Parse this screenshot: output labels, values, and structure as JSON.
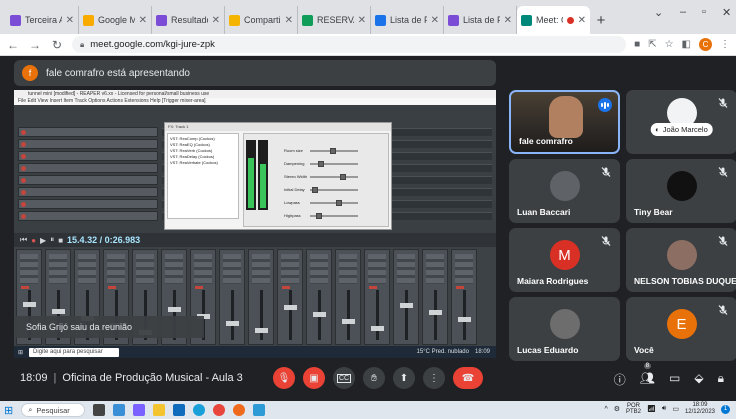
{
  "browser": {
    "tabs": [
      {
        "label": "Terceira Aula",
        "color": "#7b4dd6",
        "active": false
      },
      {
        "label": "Google Meet",
        "color": "#f9ab00",
        "active": false
      },
      {
        "label": "Resultados d",
        "color": "#7b4dd6",
        "active": false
      },
      {
        "label": "Compartilha",
        "color": "#f4b400",
        "active": false
      },
      {
        "label": "RESERVA DE",
        "color": "#0f9d58",
        "active": false
      },
      {
        "label": "Lista de Pres",
        "color": "#1a73e8",
        "active": false
      },
      {
        "label": "Lista de Pres",
        "color": "#7b4dd6",
        "active": false
      },
      {
        "label": "Meet: O",
        "color": "#00897b",
        "active": true
      }
    ],
    "url": "meet.google.com/kgi-jure-zpk",
    "profile_initial": "C"
  },
  "presenter_banner": {
    "initial": "f",
    "text": "fale comrafro está apresentando"
  },
  "shared_screen": {
    "window_title": "tunnel mini [modified] - REAPER v6.xx - Licensed for personal/small business use",
    "menu": "File  Edit  View  Insert  Item  Track  Options  Actions  Extensions  Help      [Trigger mixer-area]",
    "plugins": [
      "VST: ReaComp (Cockos)",
      "VST: ReaEQ (Cockos)",
      "VST: ReaVerb (Cockos)",
      "VST: ReaDelay (Cockos)",
      "VST: ReaVerbate (Cockos)"
    ],
    "plugin_sliders": [
      "Room size",
      "Dampening",
      "Stereo Width",
      "Initial Delay",
      "Lowpass",
      "Highpass"
    ],
    "transport_time": "15.4.32 / 0:26.983",
    "toast": "Sofia Grijó saiu da reunião",
    "taskbar_search": "Digite aqui para pesquisar",
    "weather": "15°C Pred. nublado",
    "clock": "18:09"
  },
  "participants": [
    {
      "name": "fale comrafro",
      "speaking": true,
      "type": "video"
    },
    {
      "name": "João Marcelo",
      "muted": true,
      "type": "photo-chip",
      "avatar_color": "#f1f3f4"
    },
    {
      "name": "Luan Baccari",
      "muted": true,
      "type": "photo",
      "avatar_color": "#5f6368"
    },
    {
      "name": "Tiny Bear",
      "muted": true,
      "type": "photo",
      "avatar_color": "#111111"
    },
    {
      "name": "Maiara Rodrigues",
      "muted": true,
      "type": "initial",
      "initial": "M",
      "avatar_color": "#d93025"
    },
    {
      "name": "NELSON TOBIAS DUQUE...",
      "muted": true,
      "type": "photo",
      "avatar_color": "#8d6e63"
    },
    {
      "name": "Lucas Eduardo",
      "muted": false,
      "type": "photo",
      "avatar_color": "#6d6d6d"
    },
    {
      "name": "Você",
      "muted": true,
      "type": "initial",
      "initial": "E",
      "avatar_color": "#e8710a"
    }
  ],
  "meeting": {
    "time": "18:09",
    "title": "Oficina de Produção Musical - Aula 3",
    "participant_count": "8"
  },
  "controls": [
    {
      "name": "mic-off",
      "red": true
    },
    {
      "name": "camera-off",
      "red": true
    },
    {
      "name": "captions",
      "red": false
    },
    {
      "name": "raise-hand",
      "red": false
    },
    {
      "name": "present",
      "red": false
    },
    {
      "name": "more",
      "red": false
    },
    {
      "name": "leave",
      "red": true
    }
  ],
  "win_taskbar": {
    "search_label": "Pesquisar",
    "lang": "POR",
    "lang2": "PTB2",
    "clock_time": "18:09",
    "clock_date": "12/12/2023",
    "notification_count": "1"
  }
}
